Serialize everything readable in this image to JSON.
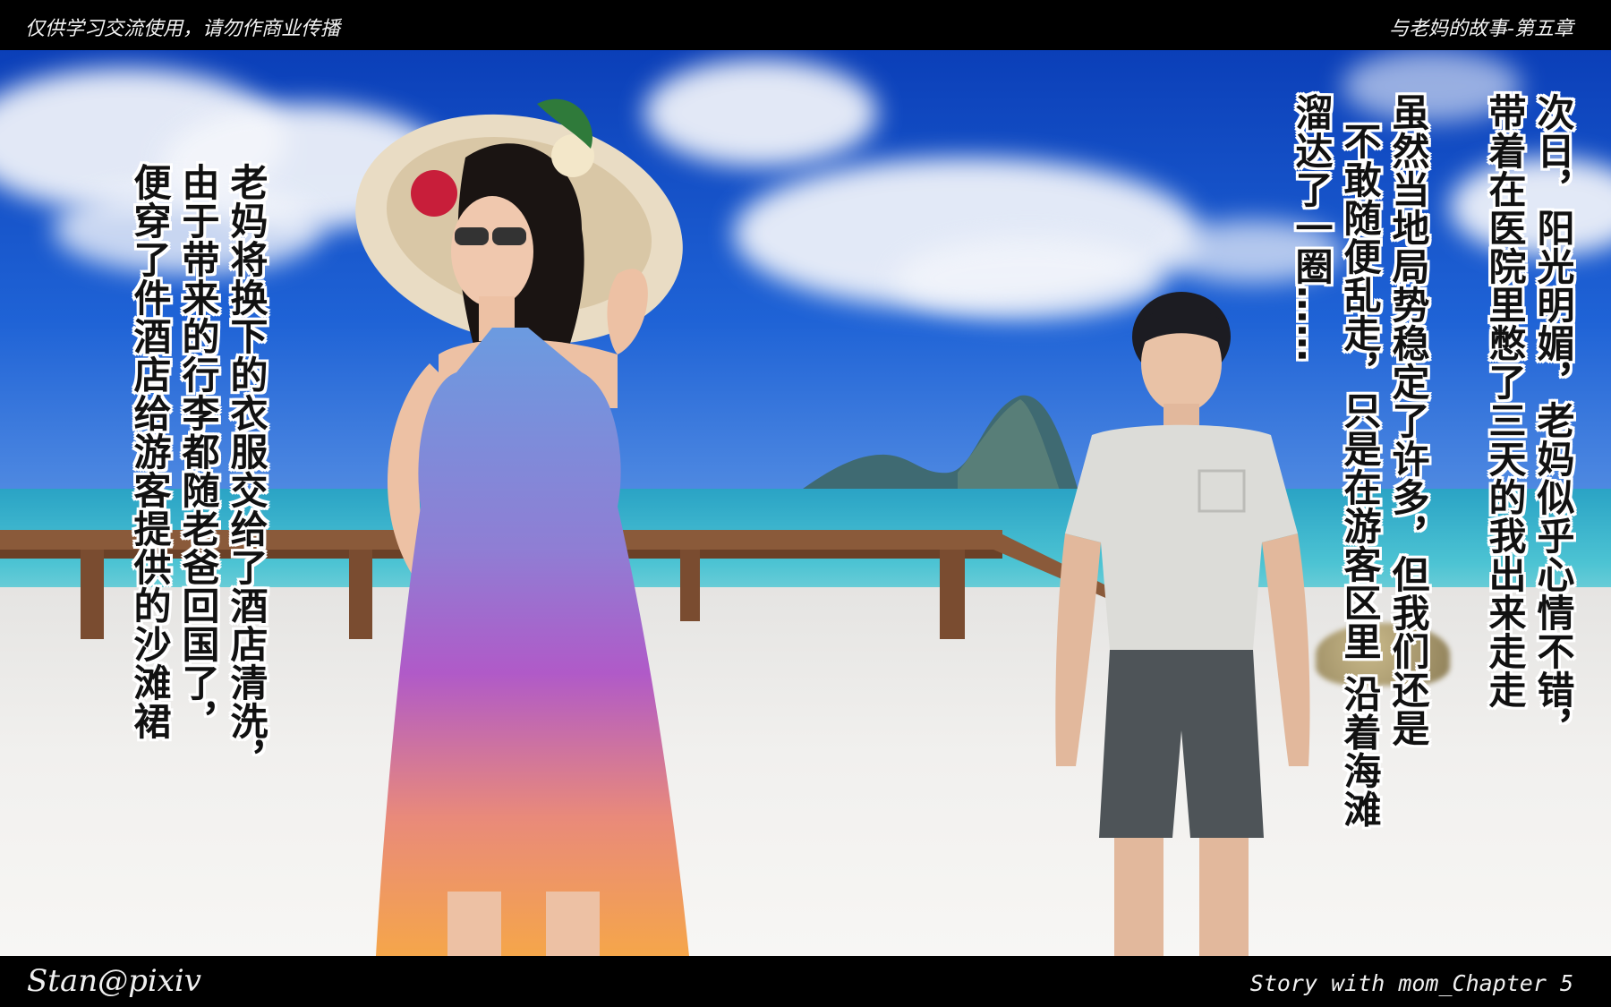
{
  "header": {
    "left_notice": "仅供学习交流使用，请勿作商业传播",
    "right_title": "与老妈的故事-第五章"
  },
  "footer": {
    "left_credit": "Stan@pixiv",
    "right_title": "Story with mom_Chapter 5"
  },
  "captions": {
    "right_block": [
      "次日，阳光明媚，老妈似乎心情不错，",
      "带着在医院里憋了三天的我出来走走",
      "虽然当地局势稳定了许多，但我们还是",
      "不敢随便乱走，只是在游客区里 沿着海滩",
      "溜达了一圈……"
    ],
    "left_block": [
      "老妈将换下的衣服交给了酒店清洗，",
      "由于带来的行李都随老爸回国了，",
      "便穿了件酒店给游客提供的沙滩裙"
    ]
  },
  "colors": {
    "sky_top": "#0b3fb8",
    "sea": "#4cc3d3",
    "sand": "#f1f0ee",
    "dress_top": "#6b9be0",
    "dress_mid": "#b05ac8",
    "dress_bottom": "#f5a64a"
  }
}
